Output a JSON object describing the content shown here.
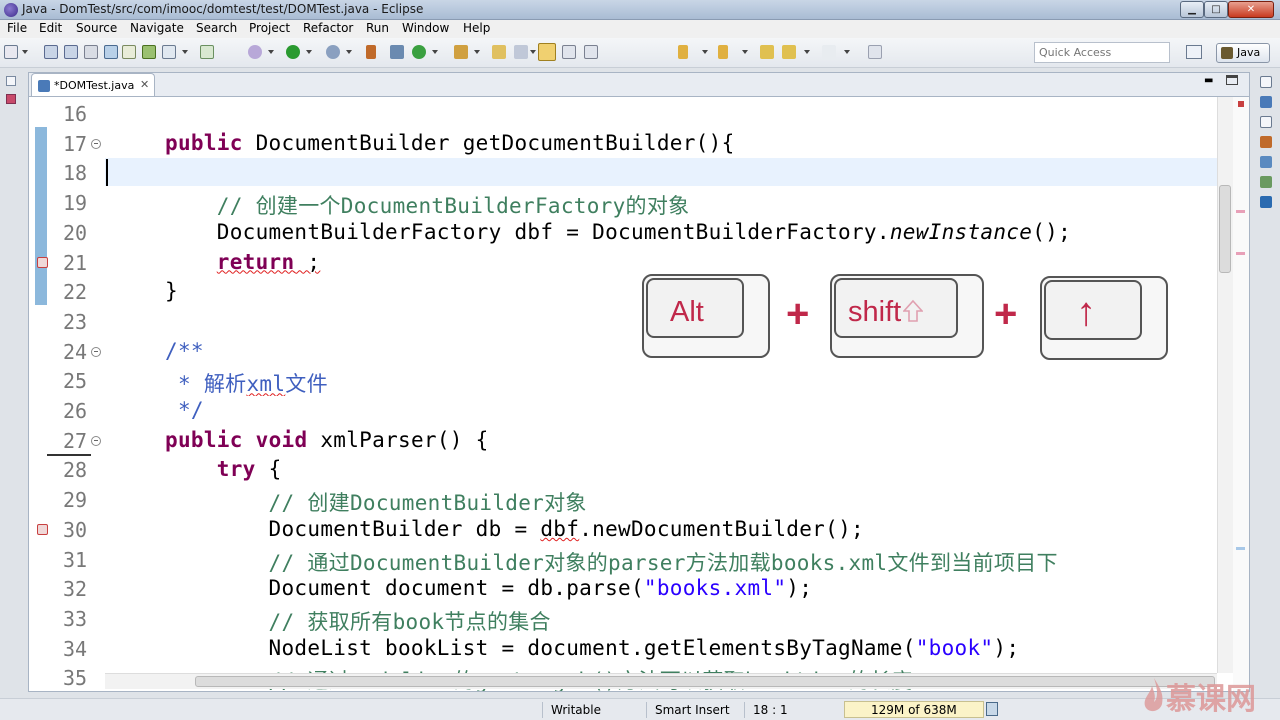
{
  "window": {
    "title": "Java - DomTest/src/com/imooc/domtest/test/DOMTest.java - Eclipse"
  },
  "menu": [
    "File",
    "Edit",
    "Source",
    "Navigate",
    "Search",
    "Project",
    "Refactor",
    "Run",
    "Window",
    "Help"
  ],
  "toolbar": {
    "quick_access_placeholder": "Quick Access",
    "perspective": "Java"
  },
  "editor": {
    "tab_label": "*DOMTest.java",
    "tab_close": "✕",
    "lines": [
      {
        "num": "16"
      },
      {
        "num": "17",
        "parts": [
          [
            "kw",
            "public"
          ],
          [
            "",
            " DocumentBuilder getDocumentBuilder(){"
          ]
        ]
      },
      {
        "num": "18"
      },
      {
        "num": "19",
        "parts": [
          [
            "cm",
            "    // 创建一个DocumentBuilderFactory的对象"
          ]
        ]
      },
      {
        "num": "20",
        "parts": [
          [
            "",
            "    DocumentBuilderFactory dbf = DocumentBuilderFactory."
          ],
          [
            "it",
            "newInstance"
          ],
          [
            "",
            "();"
          ]
        ]
      },
      {
        "num": "21",
        "parts": [
          [
            "",
            "    "
          ],
          [
            "kw sq",
            "return"
          ],
          [
            "sq",
            " ;"
          ]
        ]
      },
      {
        "num": "22",
        "parts": [
          [
            "",
            "}"
          ]
        ]
      },
      {
        "num": "23"
      },
      {
        "num": "24",
        "parts": [
          [
            "jd",
            "/**"
          ]
        ]
      },
      {
        "num": "25",
        "parts": [
          [
            "jd",
            " * 解析"
          ],
          [
            "jd sq",
            "xml"
          ],
          [
            "jd",
            "文件"
          ]
        ]
      },
      {
        "num": "26",
        "parts": [
          [
            "jd",
            " */"
          ]
        ]
      },
      {
        "num": "27",
        "parts": [
          [
            "kw",
            "public"
          ],
          [
            "",
            " "
          ],
          [
            "kw",
            "void"
          ],
          [
            "",
            " xmlParser() {"
          ]
        ]
      },
      {
        "num": "28",
        "parts": [
          [
            "",
            "    "
          ],
          [
            "kw",
            "try"
          ],
          [
            "",
            " {"
          ]
        ]
      },
      {
        "num": "29",
        "parts": [
          [
            "cm",
            "        // 创建DocumentBuilder对象"
          ]
        ]
      },
      {
        "num": "30",
        "parts": [
          [
            "",
            "        DocumentBuilder db = "
          ],
          [
            "sq",
            "dbf"
          ],
          [
            "",
            ".newDocumentBuilder();"
          ]
        ]
      },
      {
        "num": "31",
        "parts": [
          [
            "cm",
            "        // 通过DocumentBuilder对象的parser方法加载books.xml文件到当前项目下"
          ]
        ]
      },
      {
        "num": "32",
        "parts": [
          [
            "",
            "        Document document = db.parse("
          ],
          [
            "st",
            "\"books.xml\""
          ],
          [
            "",
            ");"
          ]
        ]
      },
      {
        "num": "33",
        "parts": [
          [
            "cm",
            "        // 获取所有book节点的集合"
          ]
        ]
      },
      {
        "num": "34",
        "parts": [
          [
            "",
            "        NodeList bookList = document.getElementsByTagName("
          ],
          [
            "st",
            "\"book\""
          ],
          [
            "",
            ");"
          ]
        ]
      },
      {
        "num": "35",
        "parts": [
          [
            "cm",
            "        // 通过nodelist的getLength()方法可以获取bookList的长度"
          ]
        ]
      }
    ]
  },
  "keys": {
    "alt": "Alt",
    "shift": "shift",
    "up": "↑",
    "plus": "+"
  },
  "status": {
    "writable": "Writable",
    "insert_mode": "Smart Insert",
    "position": "18 : 1",
    "heap": "129M of 638M"
  },
  "watermark": {
    "text": "慕课网"
  }
}
